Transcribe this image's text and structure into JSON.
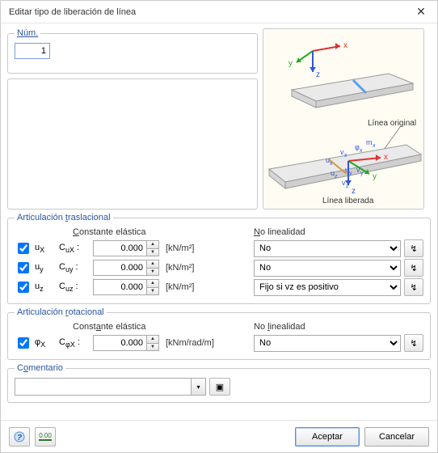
{
  "window": {
    "title": "Editar tipo de liberación de línea"
  },
  "num": {
    "label": "Núm.",
    "value": "1"
  },
  "diagram": {
    "label_original": "Línea original",
    "label_released": "Línea liberada"
  },
  "translational": {
    "legend": "Articulación traslacional",
    "const_label": "Constante elástica",
    "nl_label": "No linealidad",
    "unit": "[kN/m²]",
    "rows": [
      {
        "checked": true,
        "dof": "uX",
        "clabel": "CuX",
        "value": "0.000",
        "nl": "No"
      },
      {
        "checked": true,
        "dof": "uy",
        "clabel": "Cuy",
        "value": "0.000",
        "nl": "No"
      },
      {
        "checked": true,
        "dof": "uz",
        "clabel": "Cuz",
        "value": "0.000",
        "nl": "Fijo si vz es positivo"
      }
    ],
    "nl_options": [
      "No",
      "Fijo si vz es positivo"
    ]
  },
  "rotational": {
    "legend": "Articulación rotacional",
    "const_label": "Constante elástica",
    "nl_label": "No linealidad",
    "unit": "[kNm/rad/m]",
    "rows": [
      {
        "checked": true,
        "dof": "φX",
        "clabel": "CφX",
        "value": "0.000",
        "nl": "No"
      }
    ],
    "nl_options": [
      "No"
    ]
  },
  "comment": {
    "legend": "Comentario",
    "value": ""
  },
  "footer": {
    "ok": "Aceptar",
    "cancel": "Cancelar"
  },
  "icons": {
    "close": "✕",
    "help": "?",
    "units": "0.00",
    "pick": "▣",
    "graph": "↯",
    "dd": "▾",
    "up": "▲",
    "down": "▼"
  }
}
